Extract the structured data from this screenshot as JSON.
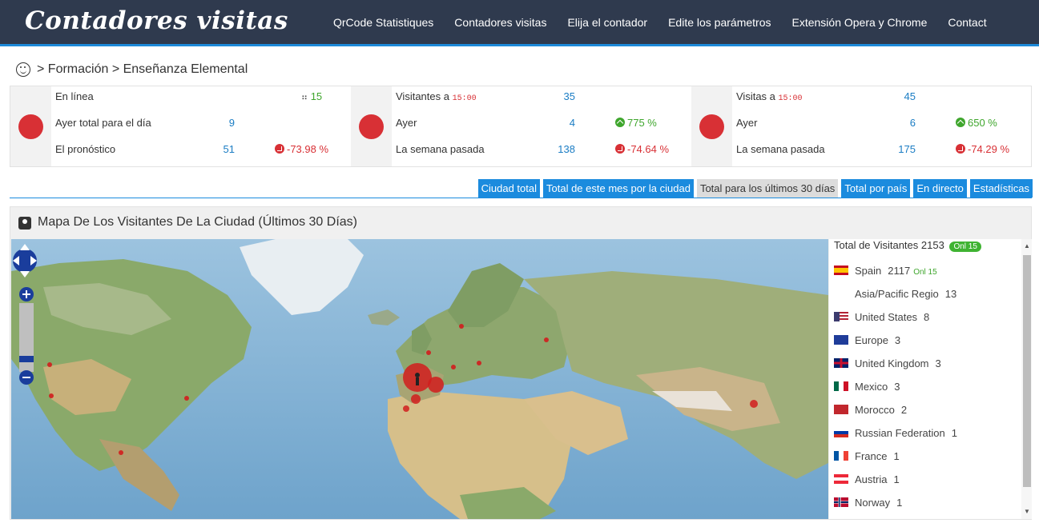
{
  "nav": {
    "logo": "Contadores visitas",
    "links": [
      "QrCode Statistiques",
      "Contadores visitas",
      "Elija el contador",
      "Edite los parámetros",
      "Extensión Opera y Chrome",
      "Contact"
    ]
  },
  "breadcrumb": "> Formación > Enseñanza Elemental",
  "stats": {
    "online": {
      "label": "En línea",
      "value": "15"
    },
    "yesterday_total": {
      "label": "Ayer total para el día",
      "value": "9"
    },
    "forecast": {
      "label": "El pronóstico",
      "value": "51",
      "pct": "-73.98 %"
    },
    "visitors": {
      "label": "Visitantes a",
      "time": "15:00",
      "value": "35",
      "yesterday_label": "Ayer",
      "yesterday_value": "4",
      "yesterday_pct": "775 %",
      "week_label": "La semana pasada",
      "week_value": "138",
      "week_pct": "-74.64 %"
    },
    "visits": {
      "label": "Visitas a",
      "time": "15:00",
      "value": "45",
      "yesterday_label": "Ayer",
      "yesterday_value": "6",
      "yesterday_pct": "650 %",
      "week_label": "La semana pasada",
      "week_value": "175",
      "week_pct": "-74.29 %"
    }
  },
  "tabs": [
    "Ciudad total",
    "Total de este mes por la ciudad",
    "Total para los últimos 30 días",
    "Total por país",
    "En directo",
    "Estadísticas"
  ],
  "active_tab": 2,
  "map_title": "Mapa De Los Visitantes De La Ciudad (Últimos 30 Días)",
  "legend": {
    "title": "Total de Visitantes",
    "total": "2153",
    "onl_badge": "Onl 15",
    "items": [
      {
        "name": "Spain",
        "count": "2117",
        "onl": "Onl 15"
      },
      {
        "name": "Asia/Pacific Regio",
        "count": "13"
      },
      {
        "name": "United States",
        "count": "8"
      },
      {
        "name": "Europe",
        "count": "3"
      },
      {
        "name": "United Kingdom",
        "count": "3"
      },
      {
        "name": "Mexico",
        "count": "3"
      },
      {
        "name": "Morocco",
        "count": "2"
      },
      {
        "name": "Russian Federation",
        "count": "1"
      },
      {
        "name": "France",
        "count": "1"
      },
      {
        "name": "Austria",
        "count": "1"
      },
      {
        "name": "Norway",
        "count": "1"
      }
    ]
  },
  "colors": {
    "nav": "#2f3a4e",
    "accent": "#1b8bde",
    "red": "#d83035",
    "green": "#3fa62d"
  }
}
